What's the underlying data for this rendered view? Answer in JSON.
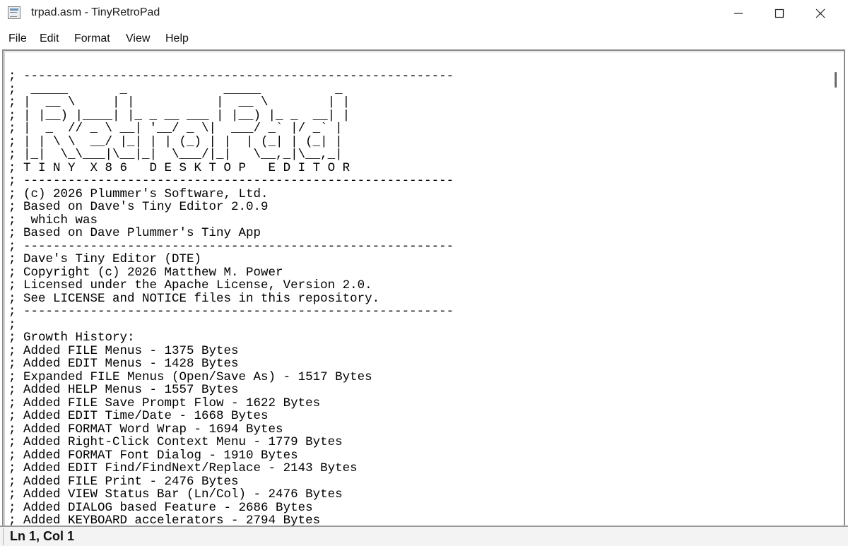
{
  "window": {
    "title": "trpad.asm - TinyRetroPad",
    "icon": "notepad-app-icon",
    "controls": {
      "minimize": "minimize-icon",
      "maximize": "maximize-icon",
      "close": "close-icon"
    }
  },
  "menu": {
    "items": [
      {
        "label": "File"
      },
      {
        "label": "Edit"
      },
      {
        "label": "Format"
      },
      {
        "label": "View"
      },
      {
        "label": "Help"
      }
    ]
  },
  "editor": {
    "lines": [
      "; ----------------------------------------------------------",
      ";  _____       _             _____          _",
      "; |  __ \\     | |           |  __ \\        | |",
      "; | |__) |____| |_ _ __ ___ | |__) |_ _  __| |",
      "; |  _  // _ \\ __| '__/ _ \\|  ___/ _` |/ _` |",
      "; | | \\ \\  __/ |_| | | (_) | |  | (_| | (_| |",
      "; |_|  \\_\\___|\\__|_|  \\___/|_|   \\__,_|\\__,_|",
      "; T I N Y  X 8 6   D E S K T O P   E D I T O R",
      "; ----------------------------------------------------------",
      "; (c) 2026 Plummer's Software, Ltd.",
      "; Based on Dave's Tiny Editor 2.0.9",
      ";  which was",
      "; Based on Dave Plummer's Tiny App",
      "; ----------------------------------------------------------",
      "; Dave's Tiny Editor (DTE)",
      "; Copyright (c) 2026 Matthew M. Power",
      "; Licensed under the Apache License, Version 2.0.",
      "; See LICENSE and NOTICE files in this repository.",
      "; ----------------------------------------------------------",
      ";",
      "; Growth History:",
      "; Added FILE Menus - 1375 Bytes",
      "; Added EDIT Menus - 1428 Bytes",
      "; Expanded FILE Menus (Open/Save As) - 1517 Bytes",
      "; Added HELP Menus - 1557 Bytes",
      "; Added FILE Save Prompt Flow - 1622 Bytes",
      "; Added EDIT Time/Date - 1668 Bytes",
      "; Added FORMAT Word Wrap - 1694 Bytes",
      "; Added Right-Click Context Menu - 1779 Bytes",
      "; Added FORMAT Font Dialog - 1910 Bytes",
      "; Added EDIT Find/FindNext/Replace - 2143 Bytes",
      "; Added FILE Print - 2476 Bytes",
      "; Added VIEW Status Bar (Ln/Col) - 2476 Bytes",
      "; Added DIALOG based Feature - 2686 Bytes",
      "; Added KEYBOARD accelerators - 2794 Bytes"
    ]
  },
  "status": {
    "position": "Ln 1, Col 1"
  }
}
